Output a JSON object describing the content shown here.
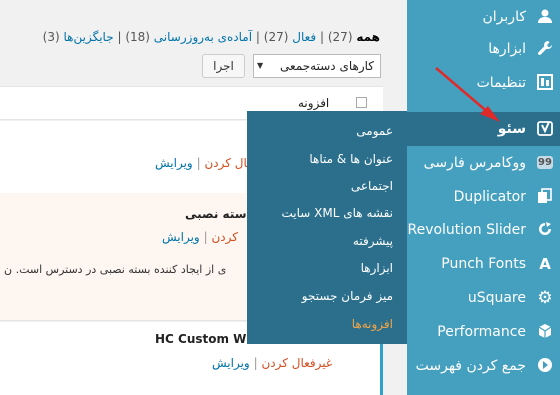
{
  "filters": {
    "all_label": "همه",
    "all_count": "(27)",
    "active_label": "فعال",
    "active_count": "(27)",
    "update_label": "آماده‌ی به‌روزرسانی",
    "update_count": "(18)",
    "dropins_label": "جایگزین‌ها",
    "dropins_count": "(3)",
    "sep": "|"
  },
  "bulk_actions": {
    "selected": "کارهای دسته‌جمعی",
    "apply_label": "اجرا"
  },
  "table": {
    "header_label": "افزونه"
  },
  "rows": [
    {
      "title": "",
      "deactivate_partial": "عال کردن",
      "sep": "|",
      "edit": "ویرایش"
    },
    {
      "title": "سته نصبی",
      "deactivate_partial": "کردن",
      "sep": "|",
      "edit": "ویرایش",
      "description": "ی از ایجاد کننده بسته نصبی در دسترس است. ن"
    },
    {
      "title": "HC Custom W",
      "deactivate": "غیرفعال کردن",
      "sep": "|",
      "edit": "ویرایش"
    }
  ],
  "sidebar": {
    "items": [
      {
        "label": "کاربران",
        "icon": "users-icon"
      },
      {
        "label": "ابزارها",
        "icon": "wrench-icon"
      },
      {
        "label": "تنظیمات",
        "icon": "settings-icon"
      },
      {
        "label": "سئو",
        "icon": "yoast-icon",
        "active": true
      },
      {
        "label": "ووکامرس فارسی",
        "icon": "woocommerce-icon"
      },
      {
        "label": "Duplicator",
        "icon": "duplicator-icon"
      },
      {
        "label": "Revolution Slider",
        "icon": "slider-icon"
      },
      {
        "label": "Punch Fonts",
        "icon": "font-icon",
        "glyph": "A"
      },
      {
        "label": "uSquare",
        "icon": "gear-icon"
      },
      {
        "label": "Performance",
        "icon": "performance-icon"
      },
      {
        "label": "جمع کردن فهرست",
        "icon": "collapse-icon"
      }
    ]
  },
  "seo_submenu": {
    "items": [
      {
        "label": "عمومی"
      },
      {
        "label": "عنوان ها & متاها"
      },
      {
        "label": "اجتماعی"
      },
      {
        "label": "نقشه های XML سایت"
      },
      {
        "label": "پیشرفته"
      },
      {
        "label": "ابزارها"
      },
      {
        "label": "میز فرمان جستجو"
      },
      {
        "label": "افزونه‌ها",
        "current": true
      }
    ]
  },
  "colors": {
    "sidebar_bg": "#45a0bf",
    "sidebar_active_bg": "#2b6f8c",
    "link_blue": "#0073aa",
    "link_orange": "#d54e21",
    "current_submenu": "#f3a545",
    "arrow_red": "#e02a2a"
  }
}
